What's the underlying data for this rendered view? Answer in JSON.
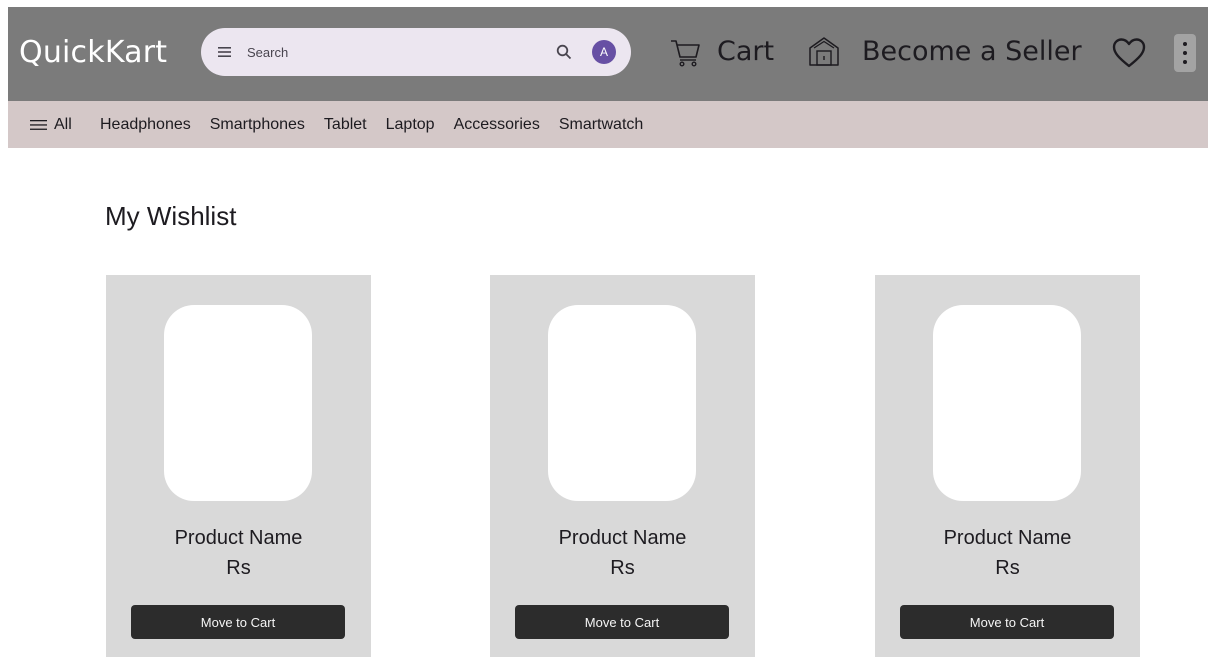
{
  "header": {
    "brand": "QuickKart",
    "search": {
      "placeholder": "Search",
      "avatar_letter": "A"
    },
    "cart_label": "Cart",
    "seller_label": "Become a Seller"
  },
  "categories": {
    "all_label": "All",
    "items": [
      "Headphones",
      "Smartphones",
      "Tablet",
      "Laptop",
      "Accessories",
      "Smartwatch"
    ]
  },
  "main": {
    "title": "My Wishlist",
    "products": [
      {
        "name": "Product Name",
        "price": "Rs",
        "button": "Move to Cart"
      },
      {
        "name": "Product Name",
        "price": "Rs",
        "button": "Move to Cart"
      },
      {
        "name": "Product Name",
        "price": "Rs",
        "button": "Move to Cart"
      }
    ]
  },
  "colors": {
    "header_bg": "#7b7b7b",
    "category_bg": "#d4c8c8",
    "search_bg": "#ece6f0",
    "avatar_bg": "#6750a4",
    "card_bg": "#d9d9d9",
    "button_bg": "#2c2c2c"
  },
  "icons": [
    "menu-icon",
    "search-icon",
    "cart-icon",
    "store-icon",
    "heart-icon",
    "more-vert-icon",
    "hamburger-icon"
  ]
}
